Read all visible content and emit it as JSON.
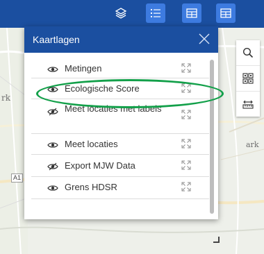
{
  "toolbar": {
    "buttons": [
      {
        "icon": "layers-icon",
        "active": false
      },
      {
        "icon": "layer-list-icon",
        "active": true
      },
      {
        "icon": "table-icon",
        "active": true
      },
      {
        "icon": "table-icon",
        "active": true
      }
    ]
  },
  "map": {
    "labels": [
      "rk",
      "ark"
    ],
    "road_badge": "A1"
  },
  "side_tools": [
    {
      "icon": "search-icon"
    },
    {
      "icon": "qr-grid-icon"
    },
    {
      "icon": "measure-icon"
    }
  ],
  "panel": {
    "title": "Kaartlagen",
    "layers": [
      {
        "name": "Metingen",
        "visibility": "visible"
      },
      {
        "name": "Ecologische Score",
        "visibility": "visible"
      },
      {
        "name": "Meet locaties met labels",
        "visibility": "hidden"
      },
      {
        "name": "Meet locaties",
        "visibility": "visible"
      },
      {
        "name": "Export MJW Data",
        "visibility": "hidden"
      },
      {
        "name": "Grens HDSR",
        "visibility": "visible"
      }
    ]
  },
  "colors": {
    "header_blue": "#1b4fa0",
    "active_button": "#3d7be0",
    "highlight_green": "#13a04a"
  }
}
